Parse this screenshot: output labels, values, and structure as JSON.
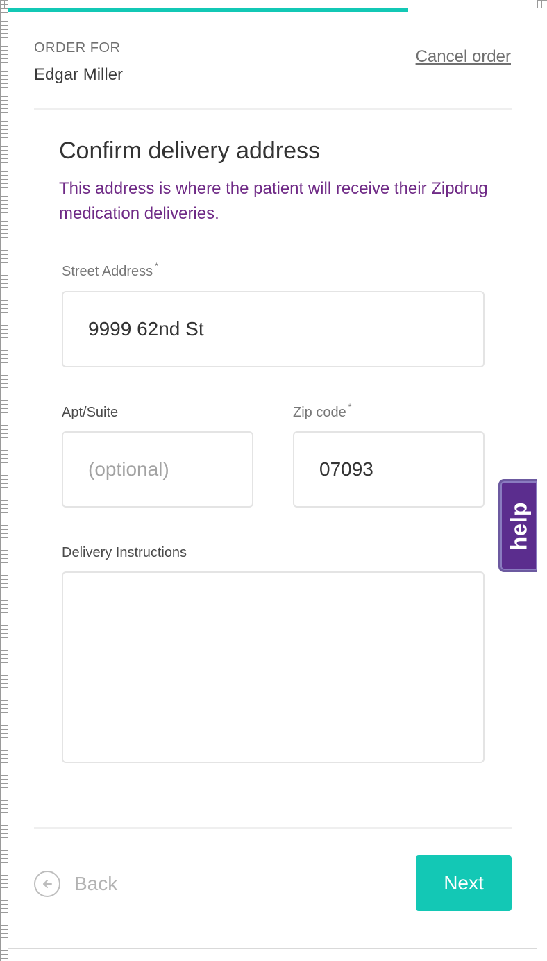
{
  "progress": {
    "percent": 75.6,
    "color": "#13c8b5"
  },
  "header": {
    "order_for_label": "ORDER FOR",
    "patient_name": "Edgar Miller",
    "cancel_label": "Cancel order"
  },
  "form": {
    "title": "Confirm delivery address",
    "subtitle": "This address is where the patient will receive their Zipdrug medication deliveries.",
    "street": {
      "label": "Street Address",
      "required_mark": "*",
      "value": "9999 62nd St"
    },
    "apt": {
      "label": "Apt/Suite",
      "placeholder": "(optional)",
      "value": ""
    },
    "zip": {
      "label": "Zip code",
      "required_mark": "*",
      "value": "07093"
    },
    "instructions": {
      "label": "Delivery Instructions",
      "value": ""
    }
  },
  "help_tab": {
    "label": "help",
    "color": "#5b2d8e"
  },
  "footer": {
    "back_label": "Back",
    "back_icon": "arrow-left-circle-icon",
    "next_label": "Next"
  },
  "colors": {
    "accent": "#13c8b5",
    "subtitle": "#6f2a86"
  }
}
